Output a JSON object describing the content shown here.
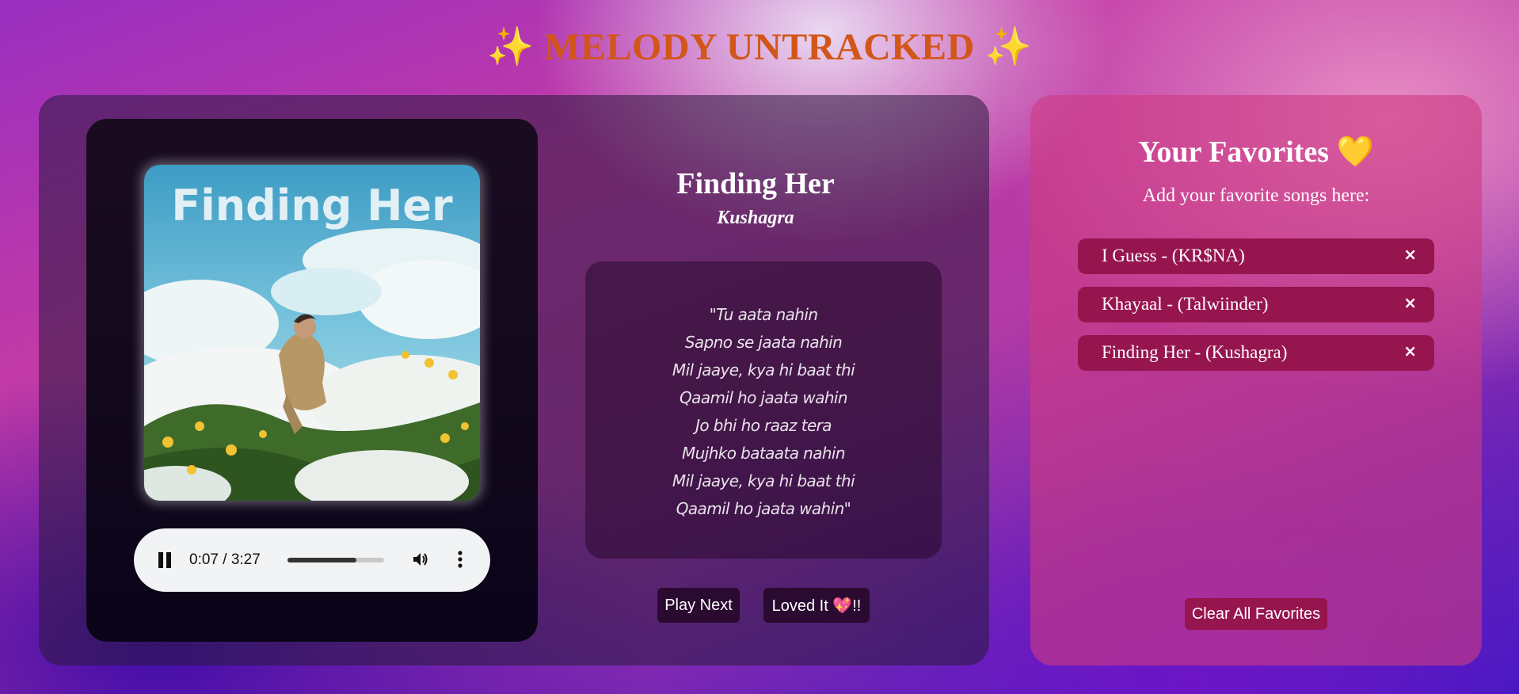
{
  "app": {
    "title": "✨ MELODY UNTRACKED ✨"
  },
  "player": {
    "cover": {
      "title_art_text": "Finding Her",
      "icon": "album-cover-image"
    },
    "audio": {
      "time": "0:07 / 3:27",
      "progress_fraction": 0.71,
      "play_state_icon": "pause-icon",
      "volume_icon": "volume-icon",
      "menu_icon": "more-vertical-icon"
    },
    "song": {
      "title": "Finding Her",
      "artist": "Kushagra"
    },
    "lyrics": [
      "\"Tu aata nahin",
      "Sapno se jaata nahin",
      "Mil jaaye, kya hi baat thi",
      "Qaamil ho jaata wahin",
      "Jo bhi ho raaz tera",
      "Mujhko bataata nahin",
      "Mil jaaye, kya hi baat thi",
      "Qaamil ho jaata wahin\""
    ],
    "buttons": {
      "play_next": "Play Next",
      "loved_it": "Loved It 💖!!"
    }
  },
  "favorites": {
    "title": "Your Favorites 💛",
    "subtitle": "Add your favorite songs here:",
    "items": [
      {
        "label": "I Guess - (KR$NA)",
        "remove": "×"
      },
      {
        "label": "Khayaal - (Talwiinder)",
        "remove": "×"
      },
      {
        "label": "Finding Her - (Kushagra)",
        "remove": "×"
      }
    ],
    "clear_label": "Clear All Favorites"
  }
}
